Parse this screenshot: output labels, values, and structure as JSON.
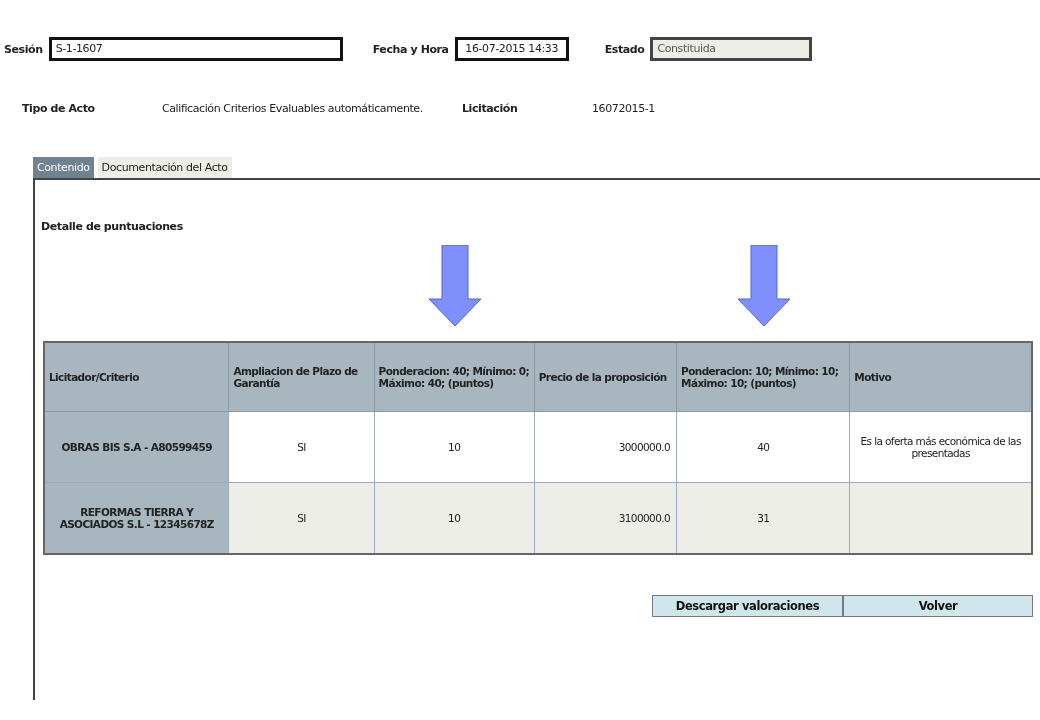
{
  "header_fields": [
    {
      "label": "Sesión",
      "value": "S-1-1607",
      "disabled": false
    },
    {
      "label": "Fecha y Hora",
      "value": "16-07-2015 14:33",
      "disabled": false
    },
    {
      "label": "Estado",
      "value": "Constituida",
      "disabled": true
    }
  ],
  "info": [
    {
      "label": "Tipo de Acto",
      "value": "Calificación Criterios Evaluables automáticamente."
    },
    {
      "label": "Licitación",
      "value": "16072015-1"
    }
  ],
  "tabs": [
    {
      "label": "Contenido",
      "selected": true
    },
    {
      "label": "Documentación del Acto",
      "selected": false
    }
  ],
  "section_title": "Detalle de puntuaciones",
  "table": {
    "columns": [
      "Licitador/Criterio",
      "Ampliacion de Plazo de Garantía",
      "Ponderacion: 40; Mínimo: 0; Máximo: 40; (puntos)",
      "Precio de la proposición",
      "Ponderacion: 10; Mínimo: 10; Máximo: 10; (puntos)",
      "Motivo"
    ],
    "rows": [
      [
        "OBRAS BIS S.A - A80599459",
        "SI",
        "10",
        "3000000.0",
        "40",
        "Es la oferta más económica de las presentadas"
      ],
      [
        "REFORMAS TIERRA Y ASOCIADOS S.L - 12345678Z",
        "SI",
        "10",
        "3100000.0",
        "31",
        ""
      ]
    ]
  },
  "buttons": [
    "Descargar valoraciones",
    "Volver"
  ]
}
